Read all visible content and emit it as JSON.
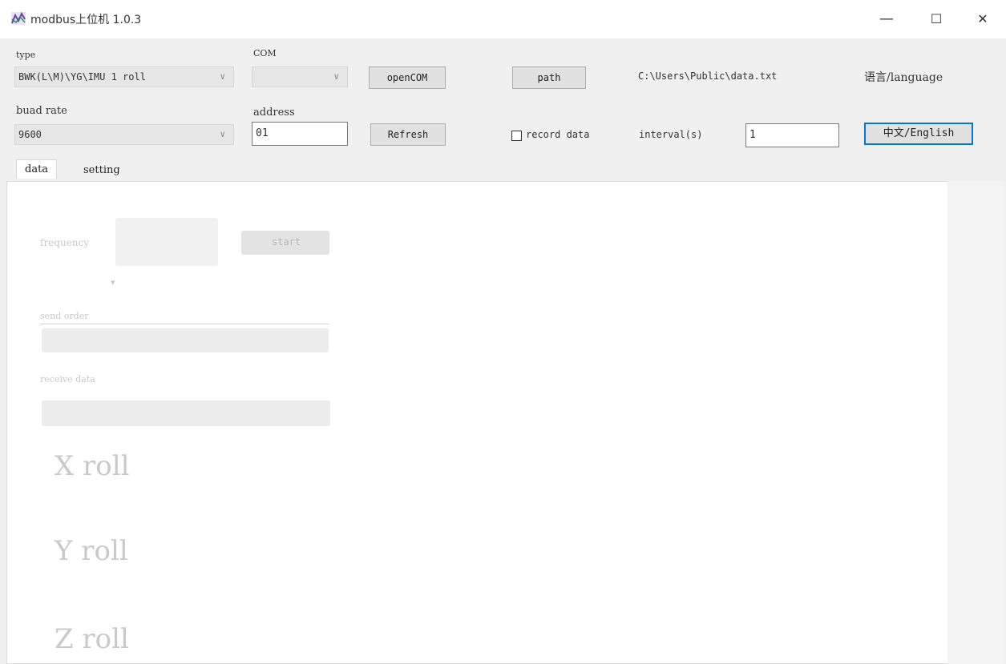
{
  "window": {
    "title": "modbus上位机  1.0.3",
    "controls": {
      "minimize": "—",
      "maximize": "☐",
      "close": "✕"
    }
  },
  "toolbar": {
    "type_label": "type",
    "type_value": "BWK(L\\M)\\YG\\IMU 1 roll",
    "com_label": "COM",
    "com_value": "",
    "open_com_label": "openCOM",
    "path_label": "path",
    "path_value": "C:\\Users\\Public\\data.txt",
    "language_label": "语言/language",
    "baud_label": "buad rate",
    "baud_value": "9600",
    "address_label": "address",
    "address_value": "01",
    "refresh_label": "Refresh",
    "record_label": "record data",
    "interval_label": "interval(s)",
    "interval_value": "1",
    "lang_button": "中文/English"
  },
  "tabs": [
    {
      "label": "data"
    },
    {
      "label": "setting"
    }
  ],
  "data_panel": {
    "frequency_label": "frequency",
    "start_label": "start",
    "send_label": "send order",
    "receive_label": "receive data",
    "x_roll": "X roll",
    "y_roll": "Y roll",
    "z_roll": "Z roll"
  },
  "colors": {
    "accent": "#0078d7",
    "window_bg": "#f0f0f0",
    "panel_bg": "#ffffff"
  }
}
